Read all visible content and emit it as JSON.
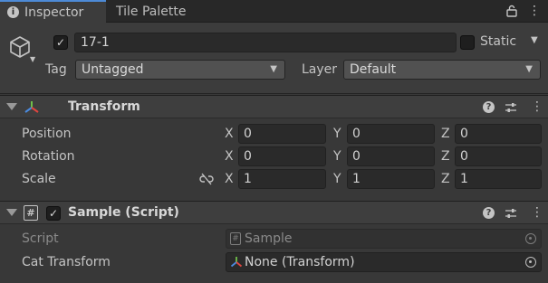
{
  "tabs": [
    {
      "label": "Inspector",
      "icon": "info-icon",
      "active": true
    },
    {
      "label": "Tile Palette",
      "active": false
    }
  ],
  "object": {
    "active": true,
    "name": "17-1",
    "static_label": "Static",
    "static_checked": false,
    "tag_label": "Tag",
    "tag_value": "Untagged",
    "layer_label": "Layer",
    "layer_value": "Default"
  },
  "transform": {
    "title": "Transform",
    "icon": "transform-axes-icon",
    "position": {
      "label": "Position",
      "x": "0",
      "y": "0",
      "z": "0"
    },
    "rotation": {
      "label": "Rotation",
      "x": "0",
      "y": "0",
      "z": "0"
    },
    "scale": {
      "label": "Scale",
      "x": "1",
      "y": "1",
      "z": "1",
      "constrain_icon": "unlinked-scale-icon"
    },
    "axis_labels": {
      "x": "X",
      "y": "Y",
      "z": "Z"
    }
  },
  "sample_script": {
    "title": "Sample (Script)",
    "icon": "csharp-script-icon",
    "enabled": true,
    "script_label": "Script",
    "script_value": "Sample",
    "cat_transform_label": "Cat Transform",
    "cat_transform_value": "None (Transform)"
  },
  "colors": {
    "background": "#383838",
    "tab_accent": "#4d8ad6",
    "field_bg": "#2a2a2a",
    "dropdown_bg": "#515151",
    "text": "#c4c4c4"
  }
}
